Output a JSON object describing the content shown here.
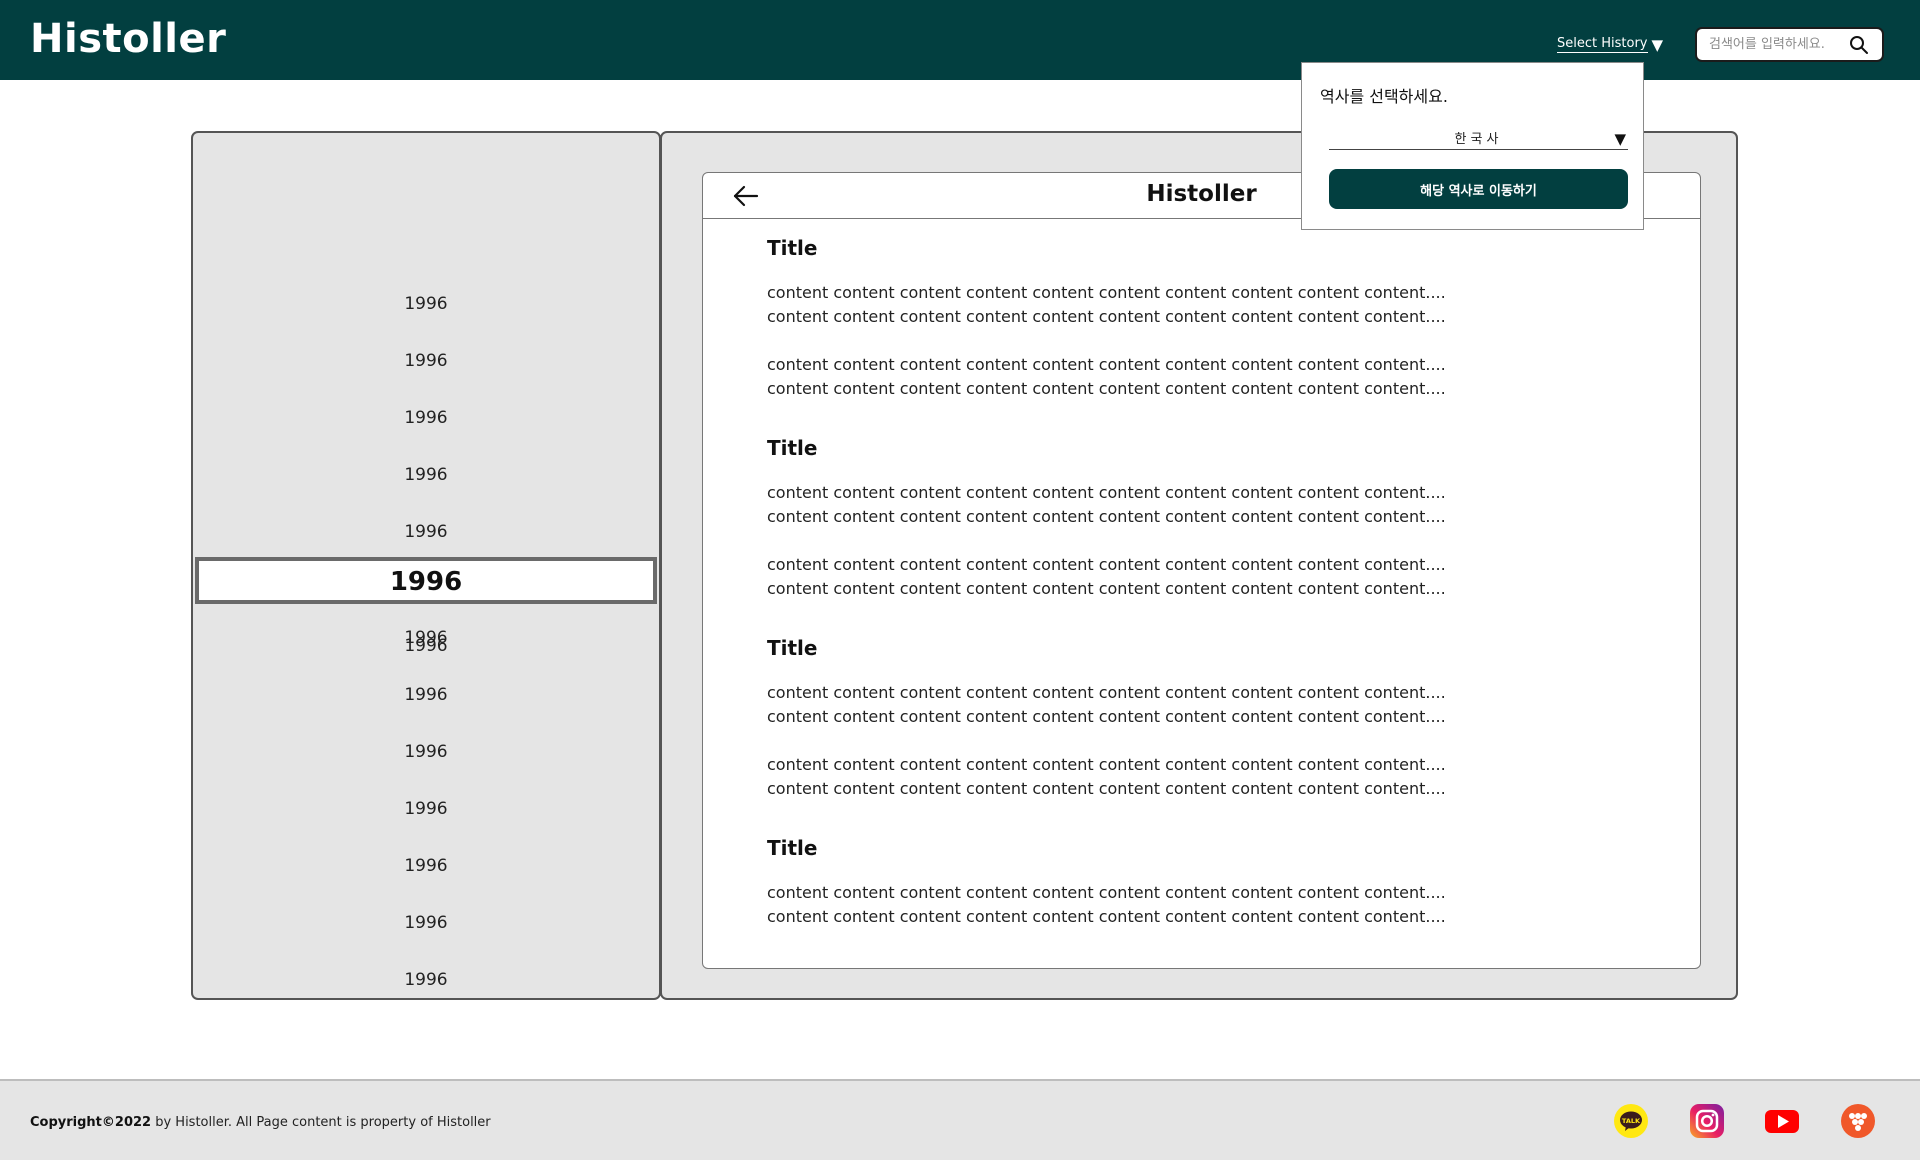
{
  "header": {
    "logo": "Histoller",
    "select_history_label": "Select History",
    "search_placeholder": "검색어를 입력하세요."
  },
  "years": {
    "items": [
      "1996",
      "1996",
      "1996",
      "1996",
      "1996",
      "1996",
      "1996",
      "1996",
      "1996",
      "1996",
      "1996",
      "1996",
      "1996",
      "1996",
      "1996"
    ],
    "selected_index": 7
  },
  "reader": {
    "title": "Histoller",
    "sections": [
      {
        "title": "Title",
        "paragraphs": [
          [
            "content content content content content content content content content content....",
            "content content content content content content content content content content...."
          ],
          [
            "content content content content content content content content content content....",
            "content content content content content content content content content content...."
          ]
        ]
      },
      {
        "title": "Title",
        "paragraphs": [
          [
            "content content content content content content content content content content....",
            "content content content content content content content content content content...."
          ],
          [
            "content content content content content content content content content content....",
            "content content content content content content content content content content...."
          ]
        ]
      },
      {
        "title": "Title",
        "paragraphs": [
          [
            "content content content content content content content content content content....",
            "content content content content content content content content content content...."
          ],
          [
            "content content content content content content content content content content....",
            "content content content content content content content content content content...."
          ]
        ]
      },
      {
        "title": "Title",
        "paragraphs": [
          [
            "content content content content content content content content content content....",
            "content content content content content content content content content content...."
          ]
        ]
      }
    ]
  },
  "popup": {
    "title": "역사를 선택하세요.",
    "selected_option": "한국사",
    "button_label": "해당 역사로 이동하기"
  },
  "footer": {
    "copyright_bold": "Copyright©2022",
    "copyright_rest": " by Histoller. All Page content is property of Histoller",
    "social": [
      "kakaotalk-icon",
      "instagram-icon",
      "youtube-icon",
      "linktree-icon"
    ]
  },
  "colors": {
    "brand": "#023f40",
    "panel": "#e5e5e5"
  }
}
